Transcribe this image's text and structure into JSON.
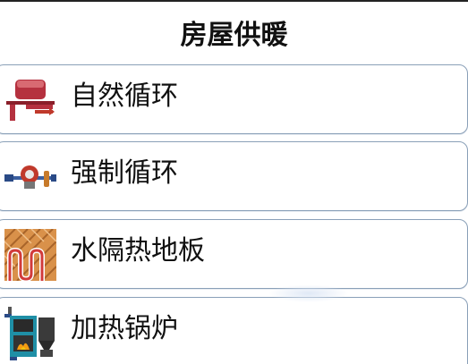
{
  "page": {
    "title": "房屋供暖"
  },
  "menu": {
    "items": [
      {
        "label": "自然循环",
        "icon": "natural-circulation-icon"
      },
      {
        "label": "强制循环",
        "icon": "pump-circulation-icon"
      },
      {
        "label": "水隔热地板",
        "icon": "underfloor-heating-icon"
      },
      {
        "label": "加热锅炉",
        "icon": "boiler-icon"
      }
    ]
  },
  "colors": {
    "item_border": "#8aa0b8",
    "pipe_red": "#c0392b",
    "floor_wood": "#d9914a",
    "boiler_teal": "#1f8fa6"
  }
}
